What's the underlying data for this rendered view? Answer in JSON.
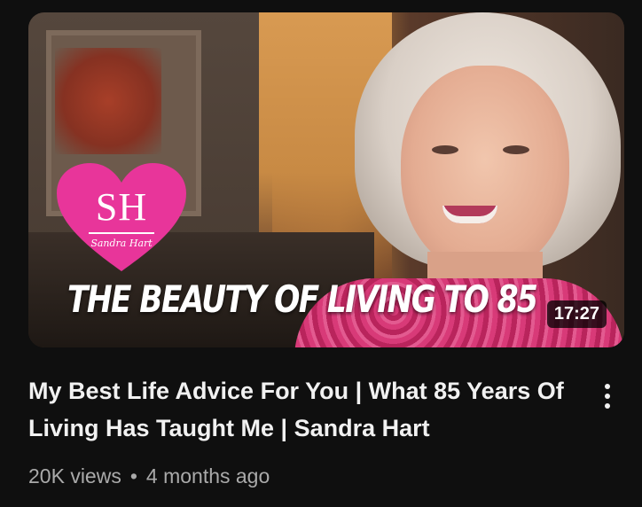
{
  "video": {
    "thumbnail_text": "THE BEAUTY OF LIVING TO 85",
    "logo_initials": "SH",
    "logo_name": "Sandra Hart",
    "duration": "17:27",
    "title": "My Best Life Advice For You | What 85 Years Of Living Has Taught Me | Sandra Hart",
    "views": "20K views",
    "separator": "•",
    "age": "4 months ago",
    "menu_icon": "more-vertical-icon"
  },
  "colors": {
    "background": "#0f0f0f",
    "title_text": "#f1f1f1",
    "meta_text": "#aaaaaa",
    "logo_pink": "#e8359a"
  }
}
